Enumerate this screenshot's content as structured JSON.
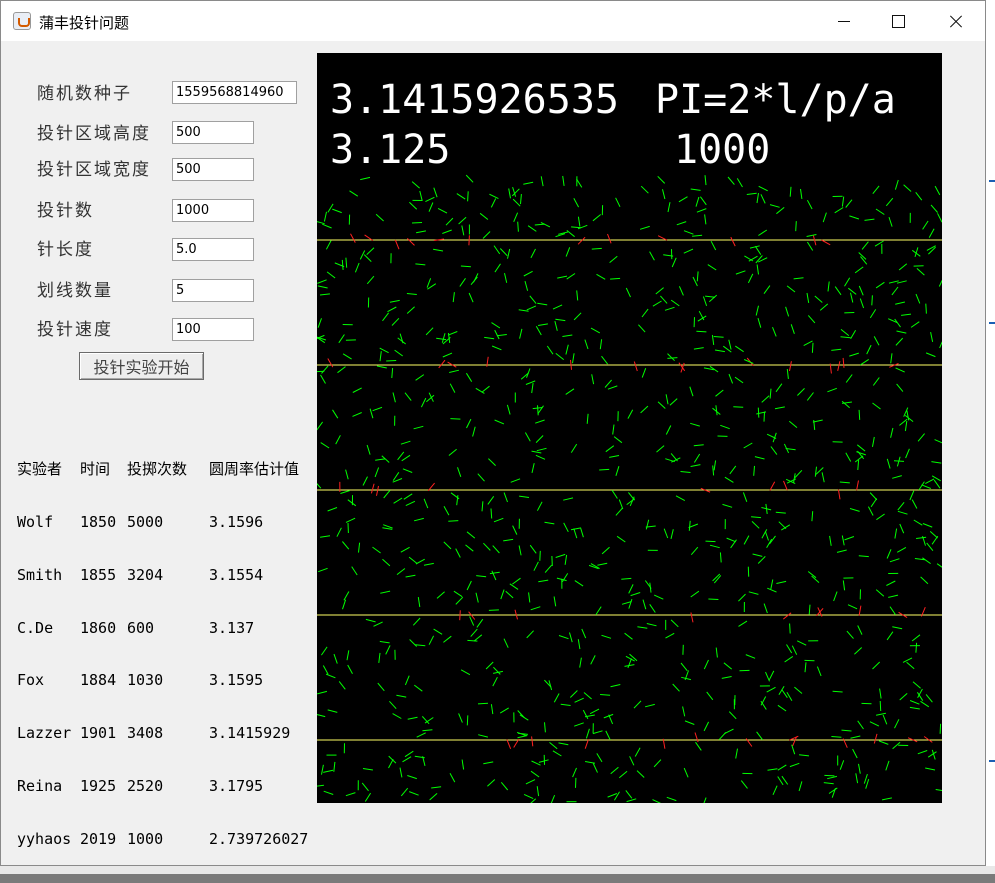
{
  "window": {
    "title": "蒲丰投针问题"
  },
  "form": {
    "fields": [
      {
        "label": "随机数种子",
        "value": "1559568814960"
      },
      {
        "label": "投针区域高度",
        "value": "500"
      },
      {
        "label": "投针区域宽度",
        "value": "500"
      },
      {
        "label": "投针数",
        "value": "1000"
      },
      {
        "label": "针长度",
        "value": "5.0"
      },
      {
        "label": "划线数量",
        "value": "5"
      },
      {
        "label": "投针速度",
        "value": "100"
      }
    ],
    "start_button": "投针实验开始"
  },
  "history": {
    "headers": [
      "实验者",
      "时间",
      "投掷次数",
      "圆周率估计值"
    ],
    "rows": [
      [
        "Wolf",
        "1850",
        "5000",
        "3.1596"
      ],
      [
        "Smith",
        "1855",
        "3204",
        "3.1554"
      ],
      [
        "C.De",
        "1860",
        "600",
        "3.137"
      ],
      [
        "Fox",
        "1884",
        "1030",
        "3.1595"
      ],
      [
        "Lazzer",
        "1901",
        "3408",
        "3.1415929"
      ],
      [
        "Reina",
        "1925",
        "2520",
        "3.1795"
      ],
      [
        "yyhaos",
        "2019",
        "1000",
        "2.739726027"
      ]
    ]
  },
  "canvas": {
    "pi_reference": "3.1415926535",
    "formula": "PI=2*l/p/a",
    "estimate": "3.125",
    "needle_count": "1000",
    "line_count": 5,
    "colors": {
      "background": "#000000",
      "line": "#ffff66",
      "needle": "#00ff00",
      "crossing_needle": "#ff2020"
    }
  }
}
